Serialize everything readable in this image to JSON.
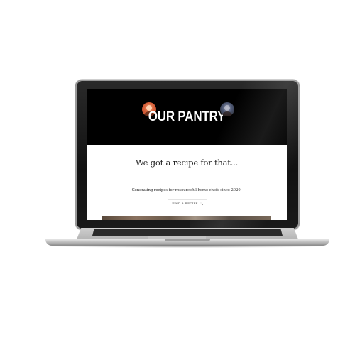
{
  "site": {
    "title": "OUR PANTRY",
    "hero_heading": "We got a recipe for that...",
    "tagline": "Generating recipes for resourceful home chefs since 2020.",
    "find_button_label": "FIND A RECIPE"
  },
  "icons": {
    "search": "search-icon"
  },
  "colors": {
    "header_bg": "#000000",
    "title_text": "#ffffff",
    "body_bg": "#ffffff"
  }
}
